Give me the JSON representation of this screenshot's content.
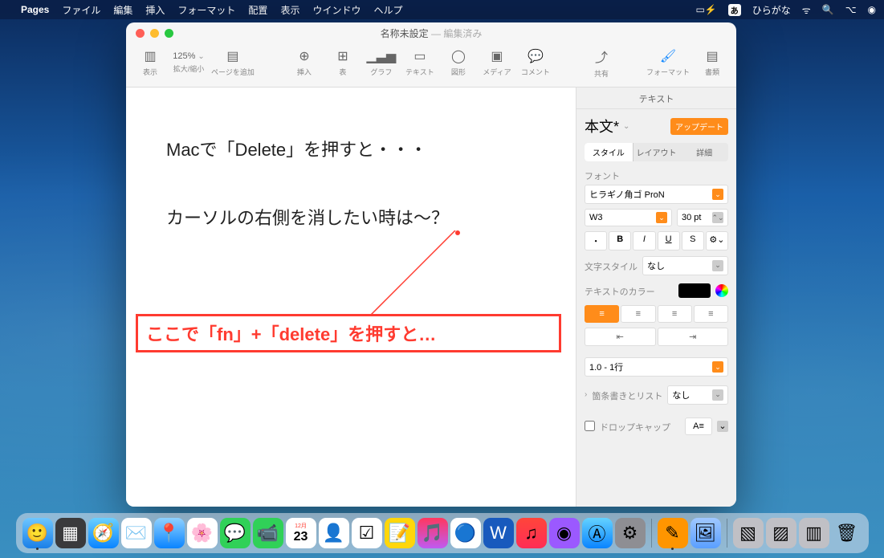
{
  "menubar": {
    "app": "Pages",
    "items": [
      "ファイル",
      "編集",
      "挿入",
      "フォーマット",
      "配置",
      "表示",
      "ウインドウ",
      "ヘルプ"
    ],
    "ime_badge": "あ",
    "ime_label": "ひらがな"
  },
  "window": {
    "title": "名称未設定",
    "subtitle": "— 編集済み",
    "toolbar": {
      "view": "表示",
      "zoom_value": "125%",
      "zoom_label": "拡大/縮小",
      "addpage": "ページを追加",
      "insert": "挿入",
      "table": "表",
      "chart": "グラフ",
      "text": "テキスト",
      "shape": "図形",
      "media": "メディア",
      "comment": "コメント",
      "share": "共有",
      "format": "フォーマット",
      "document": "書類"
    }
  },
  "doc": {
    "line1": "Macで「Delete」を押すと・・・",
    "line2": "カーソルの右側を消したい時は〜？",
    "callout": "ここで「fn」+「delete」を押すと…"
  },
  "inspector": {
    "title": "テキスト",
    "style_name": "本文*",
    "update": "アップデート",
    "tabs": {
      "style": "スタイル",
      "layout": "レイアウト",
      "detail": "詳細"
    },
    "font_label": "フォント",
    "font_name": "ヒラギノ角ゴ ProN",
    "font_weight": "W3",
    "font_size": "30 pt",
    "char_style_label": "文字スタイル",
    "char_style_value": "なし",
    "textcolor_label": "テキストのカラー",
    "spacing_value": "1.0 - 1行",
    "bullets_label": "箇条書きとリスト",
    "bullets_value": "なし",
    "dropcap_label": "ドロップキャップ",
    "dropcap_value": "A"
  },
  "dock_date": "23"
}
